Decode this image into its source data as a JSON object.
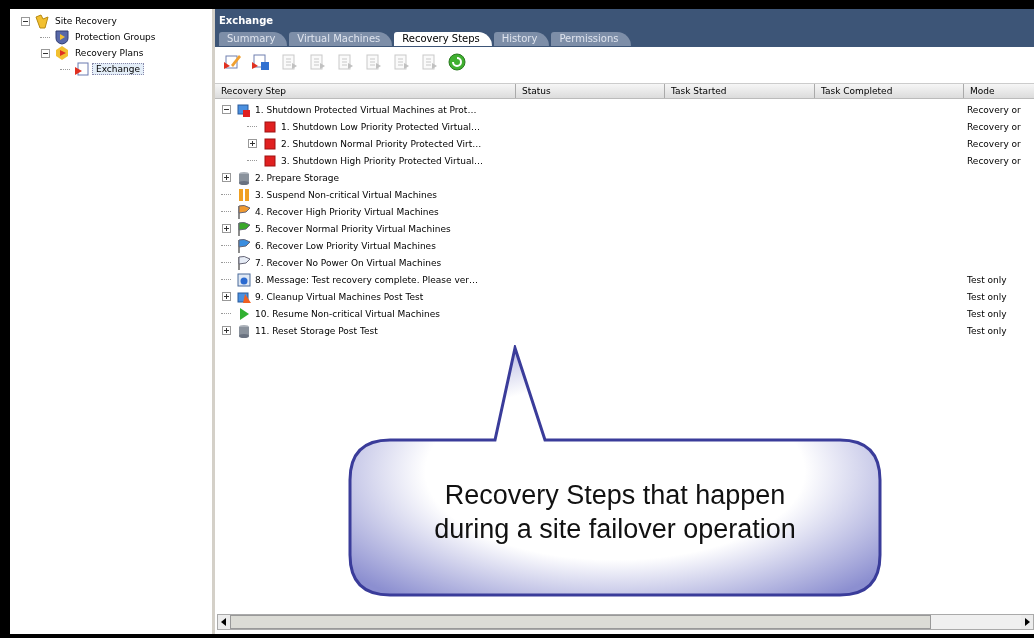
{
  "nav_tree": {
    "items": [
      {
        "label": "Site Recovery",
        "kind": "site",
        "expanded": true,
        "selected": false,
        "children": [
          {
            "label": "Protection Groups",
            "kind": "shield",
            "selected": false
          },
          {
            "label": "Recovery Plans",
            "kind": "plans",
            "expanded": true,
            "selected": false,
            "children": [
              {
                "label": "Exchange",
                "kind": "plan",
                "selected": true
              }
            ]
          }
        ]
      }
    ]
  },
  "panel": {
    "title": "Exchange",
    "tabs": [
      {
        "label": "Summary",
        "selected": false
      },
      {
        "label": "Virtual Machines",
        "selected": false
      },
      {
        "label": "Recovery Steps",
        "selected": true
      },
      {
        "label": "History",
        "selected": false
      },
      {
        "label": "Permissions",
        "selected": false
      }
    ],
    "toolbar": [
      {
        "kind": "edit",
        "disabled": false
      },
      {
        "kind": "add",
        "disabled": false
      },
      {
        "kind": "document",
        "disabled": true
      },
      {
        "kind": "document",
        "disabled": true
      },
      {
        "kind": "document",
        "disabled": true
      },
      {
        "kind": "document",
        "disabled": true
      },
      {
        "kind": "document",
        "disabled": true
      },
      {
        "kind": "document",
        "disabled": true
      },
      {
        "kind": "refresh",
        "disabled": false
      }
    ],
    "table": {
      "columns": [
        "Recovery Step",
        "Status",
        "Task Started",
        "Task Completed",
        "Mode"
      ],
      "rows": [
        {
          "step": "1. Shutdown Protected Virtual Machines at Prot…",
          "kind": "vmstop",
          "expanded": true,
          "mode": "Recovery or",
          "children": [
            {
              "step": "1. Shutdown Low Priority Protected Virtual…",
              "kind": "stop",
              "mode": "Recovery or"
            },
            {
              "step": "2. Shutdown Normal Priority Protected Virt…",
              "kind": "stop",
              "expanded": false,
              "mode": "Recovery or"
            },
            {
              "step": "3. Shutdown High Priority Protected Virtual…",
              "kind": "stop",
              "mode": "Recovery or"
            }
          ]
        },
        {
          "step": "2. Prepare Storage",
          "kind": "storage",
          "expanded": false
        },
        {
          "step": "3. Suspend Non-critical Virtual Machines",
          "kind": "pause"
        },
        {
          "step": "4. Recover High Priority Virtual Machines",
          "kind": "flag",
          "color": "#f09a30"
        },
        {
          "step": "5. Recover Normal Priority Virtual Machines",
          "kind": "flag",
          "color": "#3aa82a",
          "expanded": false
        },
        {
          "step": "6. Recover Low Priority Virtual Machines",
          "kind": "flag",
          "color": "#3a8ee0"
        },
        {
          "step": "7. Recover No Power On Virtual Machines",
          "kind": "flag",
          "color": "#e6ecf6"
        },
        {
          "step": "8. Message: Test recovery complete. Please ver…",
          "kind": "message",
          "mode": "Test only"
        },
        {
          "step": "9. Cleanup Virtual Machines Post Test",
          "kind": "cleanup",
          "expanded": false,
          "mode": "Test only"
        },
        {
          "step": "10. Resume Non-critical Virtual Machines",
          "kind": "play",
          "mode": "Test only"
        },
        {
          "step": "11. Reset Storage Post Test",
          "kind": "storage",
          "expanded": false,
          "mode": "Test only"
        }
      ]
    }
  },
  "callout": {
    "text": "Recovery Steps that happen during a site failover operation"
  }
}
